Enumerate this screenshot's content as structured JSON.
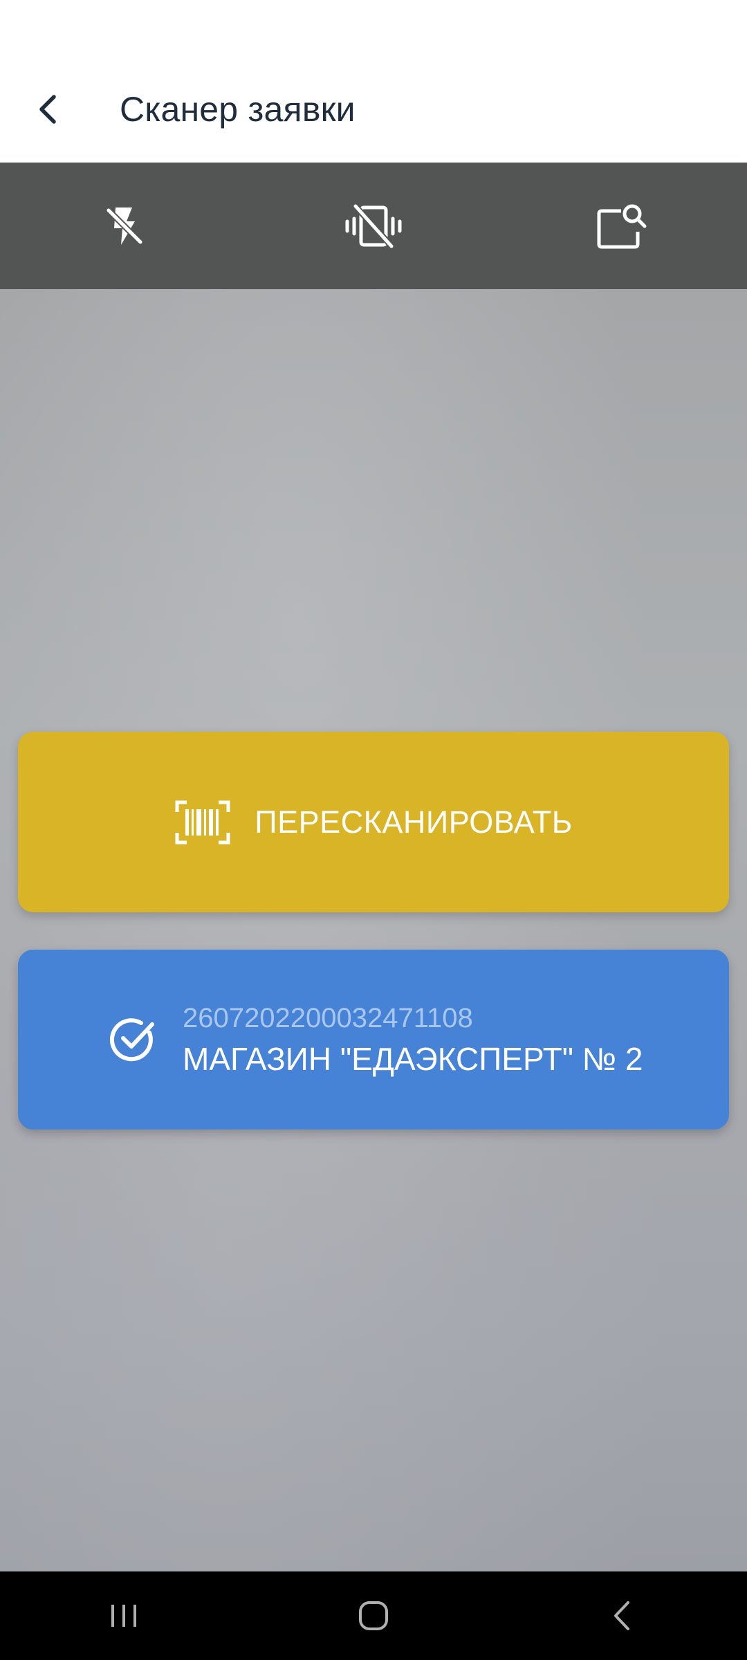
{
  "app_bar": {
    "title": "Сканер заявки",
    "back_icon": "chevron-left-icon"
  },
  "toolbar": {
    "items": [
      {
        "icon": "flash-off-icon"
      },
      {
        "icon": "vibration-off-icon"
      },
      {
        "icon": "manual-search-icon"
      }
    ]
  },
  "rescan": {
    "label": "ПЕРЕСКАНИРОВАТЬ",
    "icon": "barcode-scan-icon",
    "color": "#d9b427"
  },
  "result": {
    "code": "2607202200032471108",
    "name": "МАГАЗИН \"ЕДАЭКСПЕРТ\" № 2",
    "icon": "check-circle-icon",
    "color": "#4682d6"
  },
  "nav": {
    "items": [
      {
        "icon": "recent-apps-icon"
      },
      {
        "icon": "home-icon"
      },
      {
        "icon": "back-icon"
      }
    ]
  }
}
